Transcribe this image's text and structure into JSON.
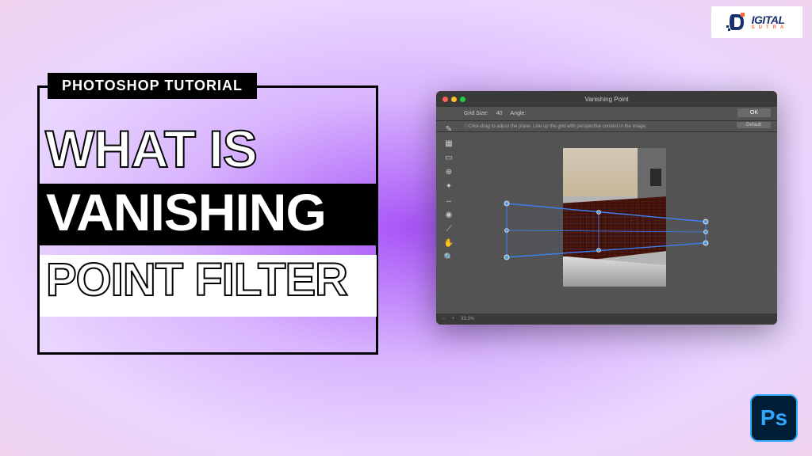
{
  "title_block": {
    "tutorial_label": "PHOTOSHOP TUTORIAL",
    "line1": "WHAT IS",
    "line2": "VANISHING",
    "line3": "POINT FILTER"
  },
  "window": {
    "title": "Vanishing Point",
    "toolbar": {
      "grid_size_label": "Grid Size:",
      "grid_size_value": "40",
      "angle_label": "Angle:",
      "ok_button": "OK",
      "default_button": "Default"
    },
    "hint": "Click-drag to adjust the plane. Line up the grid with perspective content in the image.",
    "statusbar": {
      "zoom": "33.3%"
    }
  },
  "logos": {
    "digital_sutra": {
      "brand_text": "IGITAL",
      "sub_text": "SUTRA"
    },
    "photoshop": "Ps"
  }
}
